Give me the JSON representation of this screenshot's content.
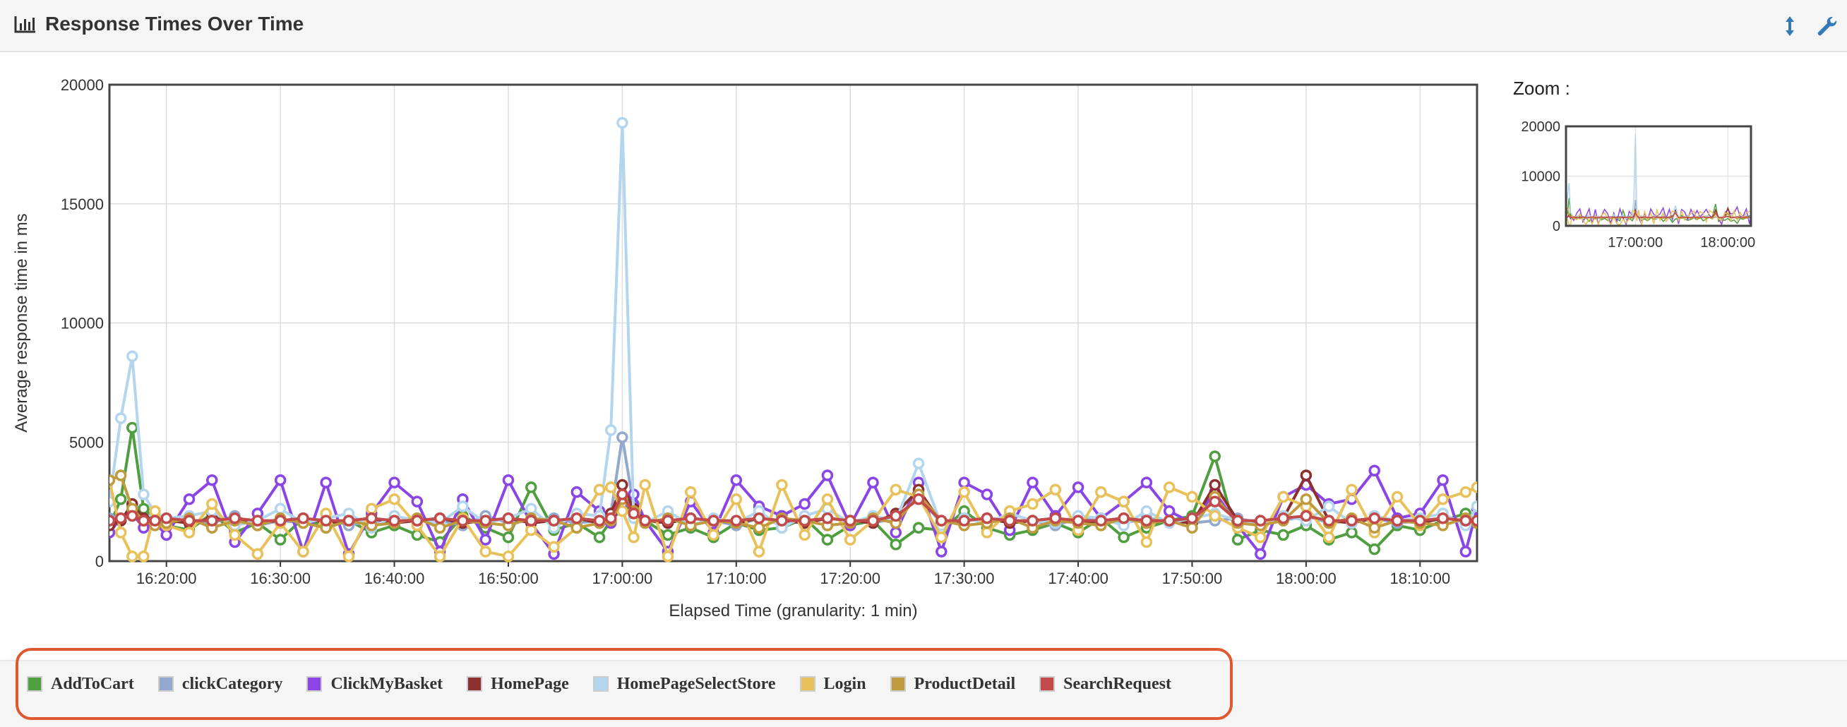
{
  "panel": {
    "title": "Response Times Over Time",
    "zoom_label": "Zoom :"
  },
  "icons": {
    "title_icon": "bar-chart-icon",
    "expand_icon": "vertical-resize-icon",
    "settings_icon": "wrench-icon"
  },
  "colors": {
    "header_icon": "#337ab7",
    "legend_highlight": "#e0582f"
  },
  "chart_data": [
    {
      "type": "line",
      "xlabel": "Elapsed Time (granularity: 1 min)",
      "ylabel": "Average response time in ms",
      "xlim": [
        "16:15:00",
        "18:15:00"
      ],
      "ylim": [
        0,
        20000
      ],
      "y_ticks": [
        0,
        5000,
        10000,
        15000,
        20000
      ],
      "x_ticks": [
        "16:20:00",
        "16:30:00",
        "16:40:00",
        "16:50:00",
        "17:00:00",
        "17:10:00",
        "17:20:00",
        "17:30:00",
        "17:40:00",
        "17:50:00",
        "18:00:00",
        "18:10:00"
      ],
      "grid": true,
      "legend_position": "bottom",
      "x": [
        "16:15:00",
        "16:16:00",
        "16:17:00",
        "16:18:00",
        "16:19:00",
        "16:20:00",
        "16:22:00",
        "16:24:00",
        "16:26:00",
        "16:28:00",
        "16:30:00",
        "16:32:00",
        "16:34:00",
        "16:36:00",
        "16:38:00",
        "16:40:00",
        "16:42:00",
        "16:44:00",
        "16:46:00",
        "16:48:00",
        "16:50:00",
        "16:52:00",
        "16:54:00",
        "16:56:00",
        "16:58:00",
        "16:59:00",
        "17:00:00",
        "17:01:00",
        "17:02:00",
        "17:04:00",
        "17:06:00",
        "17:08:00",
        "17:10:00",
        "17:12:00",
        "17:14:00",
        "17:16:00",
        "17:18:00",
        "17:20:00",
        "17:22:00",
        "17:24:00",
        "17:26:00",
        "17:28:00",
        "17:30:00",
        "17:32:00",
        "17:34:00",
        "17:36:00",
        "17:38:00",
        "17:40:00",
        "17:42:00",
        "17:44:00",
        "17:46:00",
        "17:48:00",
        "17:50:00",
        "17:52:00",
        "17:54:00",
        "17:56:00",
        "17:58:00",
        "18:00:00",
        "18:02:00",
        "18:04:00",
        "18:06:00",
        "18:08:00",
        "18:10:00",
        "18:12:00",
        "18:14:00",
        "18:15:00"
      ],
      "series": [
        {
          "name": "AddToCart",
          "color": "#4f9e3f",
          "values": [
            1500,
            2600,
            5600,
            2200,
            1800,
            1500,
            1300,
            2000,
            1200,
            1600,
            900,
            1800,
            1400,
            1700,
            1200,
            1500,
            1100,
            800,
            1900,
            1400,
            1000,
            3100,
            1300,
            1600,
            1000,
            1700,
            2200,
            2400,
            1700,
            1100,
            1400,
            1000,
            1600,
            1300,
            1400,
            1800,
            900,
            1500,
            1700,
            700,
            1400,
            1300,
            2100,
            1400,
            1100,
            1300,
            1600,
            1200,
            1800,
            1000,
            1400,
            1700,
            1900,
            4400,
            900,
            1300,
            1100,
            1500,
            900,
            1200,
            500,
            1500,
            1300,
            1700,
            2000,
            1600
          ]
        },
        {
          "name": "clickCategory",
          "color": "#92a8cd",
          "values": [
            1800,
            1700,
            2300,
            1700,
            1600,
            1800,
            1700,
            1600,
            1900,
            1500,
            1700,
            1600,
            1800,
            1500,
            1700,
            1600,
            1800,
            1700,
            1500,
            1900,
            1600,
            1700,
            1800,
            1600,
            1700,
            2000,
            5200,
            2300,
            1700,
            1600,
            1800,
            1700,
            1500,
            1800,
            1700,
            1600,
            1800,
            1700,
            1600,
            1800,
            2700,
            1600,
            1700,
            1800,
            1600,
            1700,
            1500,
            1800,
            1700,
            1600,
            1800,
            1700,
            1600,
            1700,
            1800,
            1600,
            1700,
            1900,
            1600,
            1700,
            1800,
            1600,
            1700,
            1800,
            1700,
            1600
          ]
        },
        {
          "name": "ClickMyBasket",
          "color": "#8a45e6",
          "values": [
            1200,
            1800,
            2000,
            1400,
            1600,
            1100,
            2600,
            3400,
            800,
            2000,
            3400,
            400,
            3300,
            300,
            2000,
            3300,
            2500,
            400,
            2600,
            900,
            3400,
            1600,
            300,
            2900,
            2100,
            1600,
            2400,
            2800,
            1700,
            400,
            2500,
            1200,
            3400,
            2300,
            1900,
            2400,
            3600,
            1500,
            3300,
            1200,
            3300,
            400,
            3300,
            2800,
            1300,
            3300,
            1900,
            3100,
            1800,
            2500,
            3300,
            2100,
            1600,
            2900,
            1500,
            300,
            2700,
            3200,
            2400,
            2600,
            3800,
            1800,
            2000,
            3400,
            400,
            2200
          ]
        },
        {
          "name": "HomePage",
          "color": "#8e2f2f",
          "values": [
            1500,
            1700,
            2400,
            1800,
            1600,
            1700,
            1600,
            1800,
            1700,
            1600,
            1700,
            1800,
            1600,
            1700,
            1800,
            1600,
            1700,
            1800,
            1600,
            1700,
            1800,
            1600,
            1700,
            1800,
            1600,
            2000,
            3200,
            2200,
            1700,
            1600,
            1800,
            1700,
            1600,
            1800,
            1700,
            1600,
            1800,
            1700,
            1600,
            2000,
            3000,
            1600,
            1700,
            1800,
            1600,
            1700,
            1800,
            1600,
            1700,
            1800,
            1600,
            1700,
            1600,
            3200,
            1700,
            1600,
            1800,
            3600,
            1700,
            1600,
            1800,
            1700,
            1600,
            1800,
            1700,
            1600
          ]
        },
        {
          "name": "HomePageSelectStore",
          "color": "#b3d5ee",
          "values": [
            2500,
            6000,
            8600,
            2800,
            2000,
            1800,
            1900,
            2100,
            1500,
            1700,
            2200,
            1600,
            1800,
            2000,
            1400,
            1900,
            1700,
            1600,
            2300,
            1600,
            1800,
            2200,
            1400,
            2000,
            1900,
            5500,
            18400,
            1800,
            1600,
            2100,
            1500,
            1800,
            1600,
            2100,
            1400,
            1900,
            2200,
            1600,
            1900,
            1700,
            4100,
            1500,
            1800,
            1600,
            2000,
            1700,
            1600,
            1900,
            1800,
            1500,
            2100,
            1600,
            1800,
            2000,
            1700,
            1500,
            1900,
            1700,
            2300,
            1600,
            1900,
            1700,
            1800,
            2000,
            1500,
            2300
          ]
        },
        {
          "name": "Login",
          "color": "#e8c15a",
          "values": [
            3400,
            1200,
            200,
            200,
            2100,
            1500,
            1200,
            2400,
            1100,
            300,
            1600,
            400,
            2000,
            200,
            2200,
            2600,
            1500,
            200,
            1800,
            400,
            200,
            1300,
            600,
            1400,
            3000,
            3100,
            2100,
            1000,
            3200,
            200,
            2900,
            1100,
            2600,
            400,
            3200,
            1100,
            2600,
            900,
            1700,
            3000,
            2700,
            1000,
            2900,
            1200,
            2100,
            2400,
            3000,
            1300,
            2900,
            2500,
            800,
            3100,
            2700,
            1900,
            1400,
            1000,
            2700,
            2300,
            1000,
            3000,
            1200,
            2700,
            1500,
            2600,
            2900,
            3100
          ]
        },
        {
          "name": "ProductDetail",
          "color": "#bf9b3e",
          "values": [
            3400,
            3600,
            2200,
            1700,
            1500,
            1600,
            1800,
            1400,
            1700,
            1500,
            1800,
            1600,
            1400,
            1700,
            1500,
            1600,
            1800,
            1400,
            1700,
            1600,
            1500,
            1800,
            1700,
            1400,
            1600,
            1700,
            2600,
            2100,
            1600,
            1800,
            1500,
            1700,
            1600,
            1400,
            1800,
            1700,
            1500,
            1600,
            1800,
            1600,
            2800,
            1700,
            1500,
            1600,
            1800,
            1400,
            1700,
            1600,
            1500,
            1800,
            1600,
            1700,
            1400,
            2700,
            1600,
            1500,
            1700,
            2600,
            1600,
            1800,
            1400,
            1700,
            1600,
            1500,
            1800,
            1600
          ]
        },
        {
          "name": "SearchRequest",
          "color": "#c24a4a",
          "values": [
            1700,
            1800,
            1900,
            1700,
            1700,
            1800,
            1700,
            1700,
            1800,
            1700,
            1700,
            1800,
            1700,
            1700,
            1800,
            1700,
            1700,
            1800,
            1700,
            1700,
            1800,
            1700,
            1700,
            1800,
            1700,
            1800,
            2800,
            2000,
            1700,
            1700,
            1800,
            1700,
            1700,
            1800,
            1700,
            1700,
            1800,
            1700,
            1700,
            1900,
            2600,
            1700,
            1700,
            1800,
            1700,
            1700,
            1800,
            1700,
            1700,
            1800,
            1700,
            1700,
            1800,
            2500,
            1700,
            1700,
            1800,
            1900,
            1700,
            1700,
            1800,
            1700,
            1700,
            1800,
            1700,
            1700
          ]
        }
      ]
    },
    {
      "type": "line",
      "role": "zoom-overview",
      "ylim": [
        0,
        20000
      ],
      "y_ticks": [
        0,
        10000,
        20000
      ],
      "x_ticks": [
        "17:00:00",
        "18:00:00"
      ],
      "grid": true
    }
  ]
}
